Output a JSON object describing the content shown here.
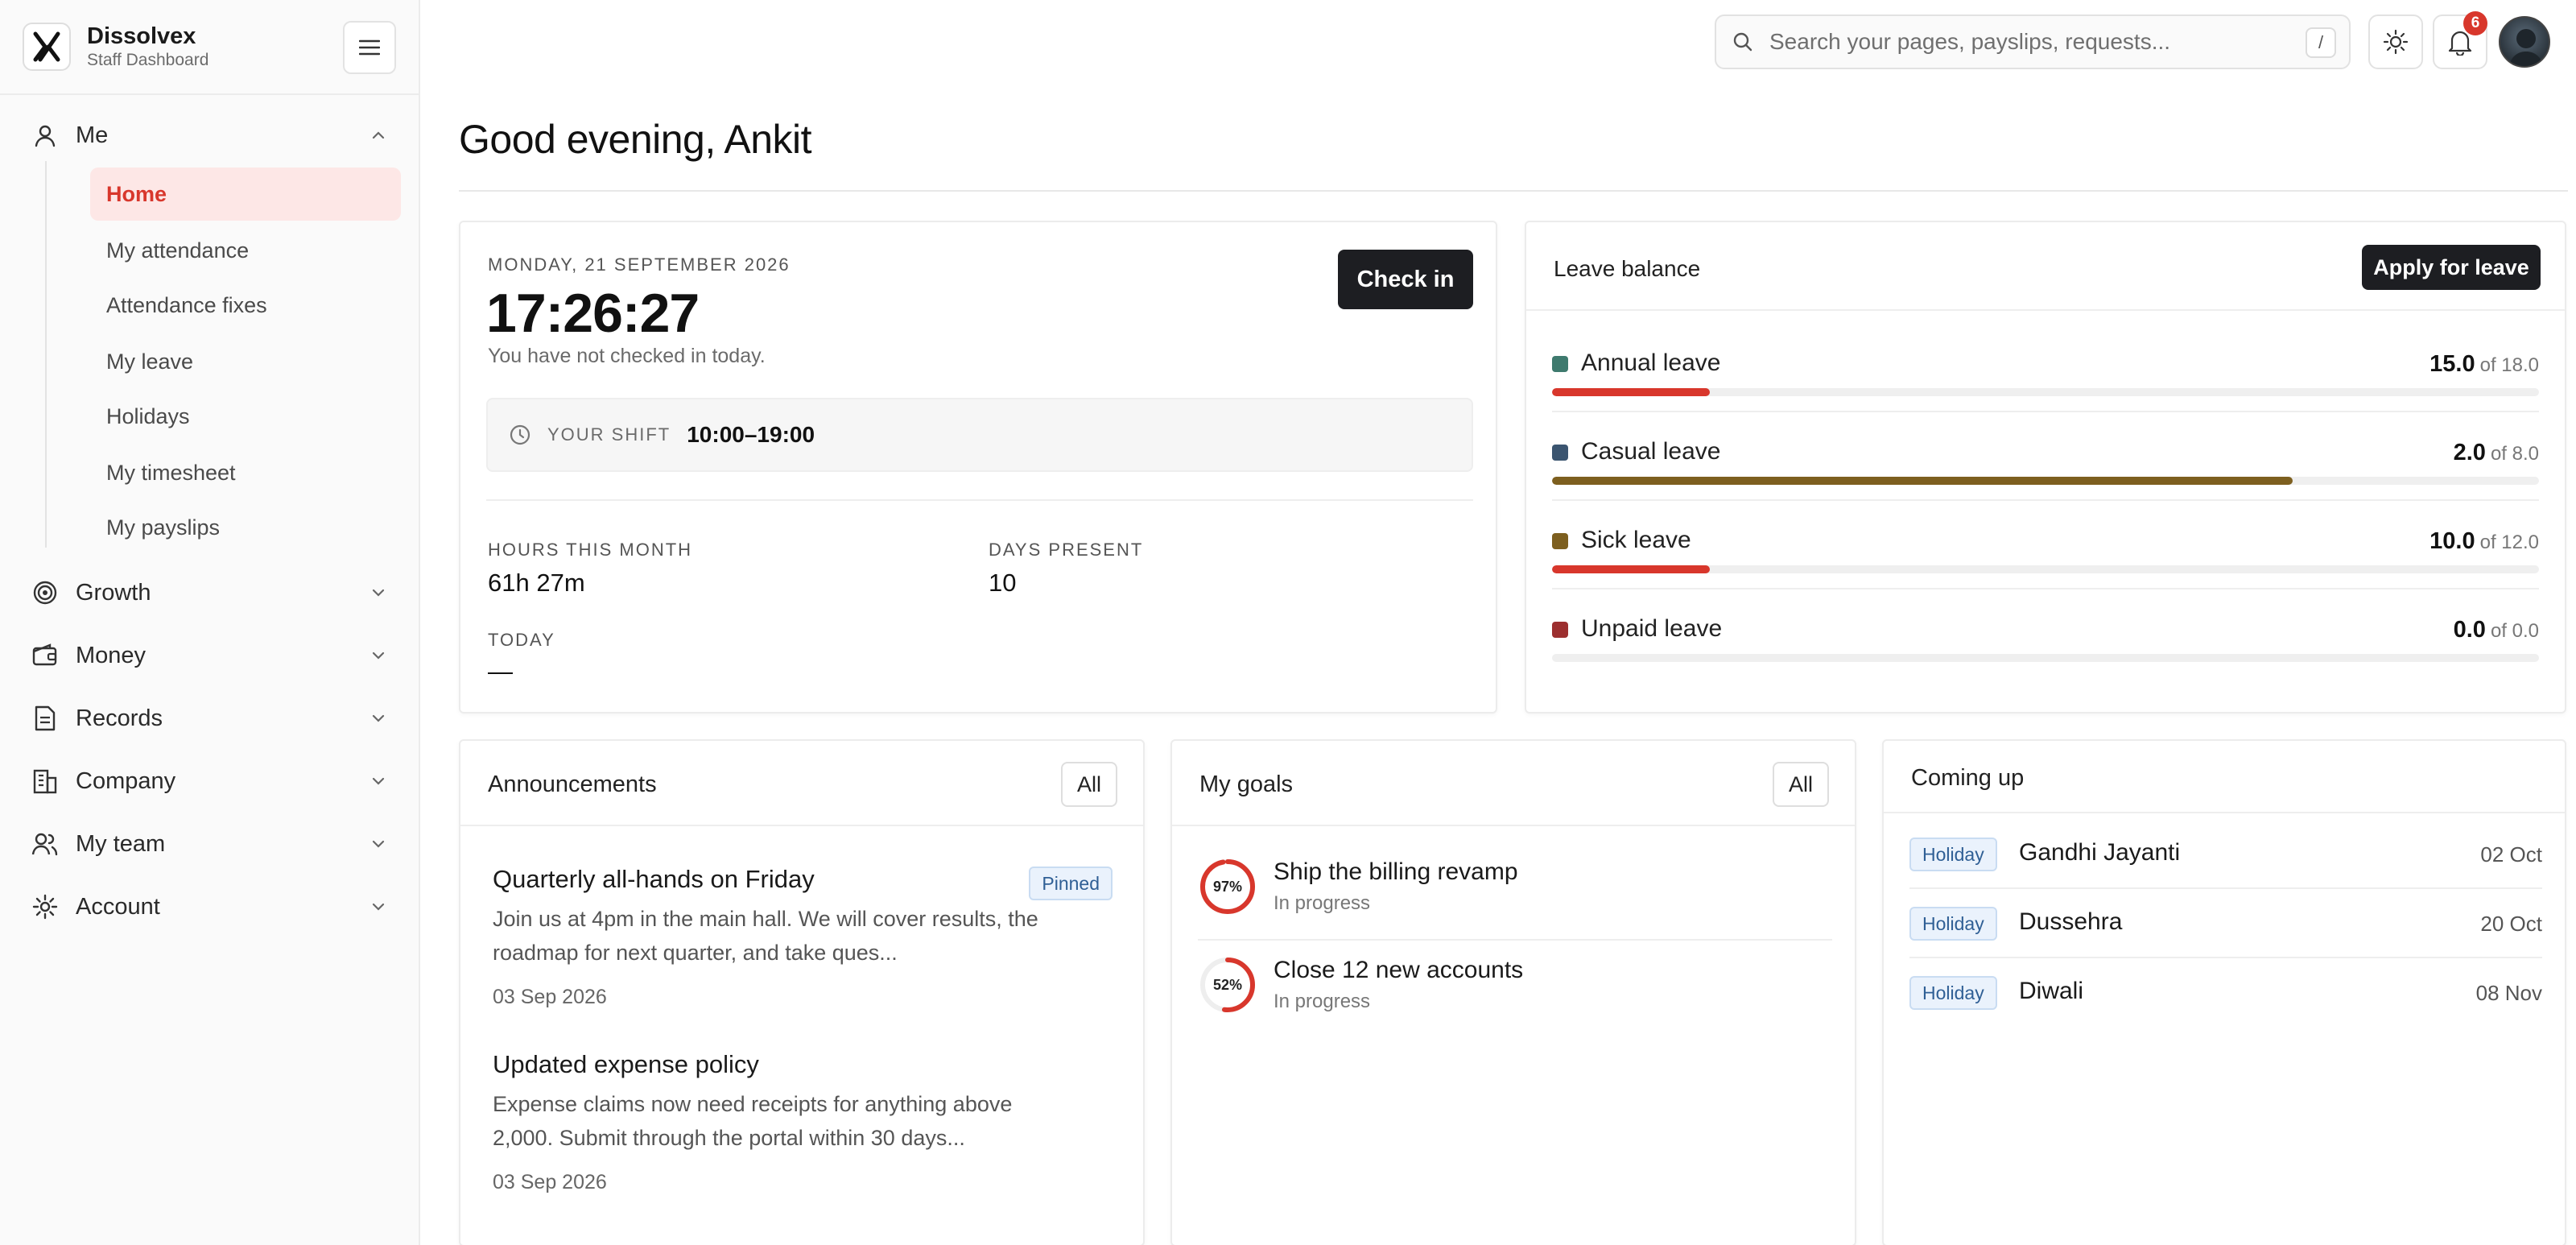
{
  "brand": {
    "name": "Dissolvex",
    "subtitle": "Staff Dashboard"
  },
  "sidebar": {
    "groups": [
      {
        "label": "Me",
        "icon": "user-icon",
        "expanded": true
      },
      {
        "label": "Growth",
        "icon": "target-icon"
      },
      {
        "label": "Money",
        "icon": "wallet-icon"
      },
      {
        "label": "Records",
        "icon": "document-icon"
      },
      {
        "label": "Company",
        "icon": "building-icon"
      },
      {
        "label": "My team",
        "icon": "team-icon"
      },
      {
        "label": "Account",
        "icon": "gear-icon"
      }
    ],
    "me_items": [
      {
        "label": "Home",
        "active": true
      },
      {
        "label": "My attendance"
      },
      {
        "label": "Attendance fixes"
      },
      {
        "label": "My leave"
      },
      {
        "label": "Holidays"
      },
      {
        "label": "My timesheet"
      },
      {
        "label": "My payslips"
      }
    ]
  },
  "topbar": {
    "search_placeholder": "Search your pages, payslips, requests...",
    "search_shortcut": "/",
    "notifications_count": "6"
  },
  "greeting": "Good evening, Ankit",
  "attendance": {
    "date": "MONDAY, 21 SEPTEMBER 2026",
    "time": "17:26:27",
    "status": "You have not checked in today.",
    "checkin_label": "Check in",
    "shift_label": "YOUR SHIFT",
    "shift_value": "10:00–19:00",
    "hours_label": "HOURS THIS MONTH",
    "hours_value": "61h 27m",
    "days_label": "DAYS PRESENT",
    "days_value": "10",
    "today_label": "TODAY",
    "today_value": "—"
  },
  "leave": {
    "title": "Leave balance",
    "apply_label": "Apply for leave",
    "items": [
      {
        "name": "Annual leave",
        "remaining": "15.0",
        "total": "of 18.0",
        "used_fraction": 0.16,
        "dot_color": "#3e7a6e",
        "bar_color": "#d8372c"
      },
      {
        "name": "Casual leave",
        "remaining": "2.0",
        "total": "of 8.0",
        "used_fraction": 0.75,
        "dot_color": "#3b5570",
        "bar_color": "#7d5f1f"
      },
      {
        "name": "Sick leave",
        "remaining": "10.0",
        "total": "of 12.0",
        "used_fraction": 0.16,
        "dot_color": "#7d5f1f",
        "bar_color": "#d8372c"
      },
      {
        "name": "Unpaid leave",
        "remaining": "0.0",
        "total": "of 0.0",
        "used_fraction": 0,
        "dot_color": "#9c2f2f",
        "bar_color": "#d8372c"
      }
    ]
  },
  "announcements": {
    "title": "Announcements",
    "all_label": "All",
    "items": [
      {
        "title": "Quarterly all-hands on Friday",
        "body_line1": "Join us at 4pm in the main hall. We will cover results, the",
        "body_line2": "roadmap for next quarter, and take ques...",
        "date": "03 Sep 2026",
        "badge": "Pinned"
      },
      {
        "title": "Updated expense policy",
        "body_line1": "Expense claims now need receipts for anything above",
        "body_line2": "2,000. Submit through the portal within 30 days...",
        "date": "03 Sep 2026"
      }
    ]
  },
  "goals": {
    "title": "My goals",
    "all_label": "All",
    "items": [
      {
        "name": "Ship the billing revamp",
        "status": "In progress",
        "percent": 97,
        "percent_label": "97%"
      },
      {
        "name": "Close 12 new accounts",
        "status": "In progress",
        "percent": 52,
        "percent_label": "52%"
      }
    ]
  },
  "coming_up": {
    "title": "Coming up",
    "items": [
      {
        "tag": "Holiday",
        "name": "Gandhi Jayanti",
        "date": "02 Oct"
      },
      {
        "tag": "Holiday",
        "name": "Dussehra",
        "date": "20 Oct"
      },
      {
        "tag": "Holiday",
        "name": "Diwali",
        "date": "08 Nov"
      }
    ]
  },
  "colors": {
    "accent": "#d8372c",
    "dark_button": "#1d1e22",
    "active_bg": "#fde7e6",
    "tag_bg": "#eaf2fc"
  }
}
